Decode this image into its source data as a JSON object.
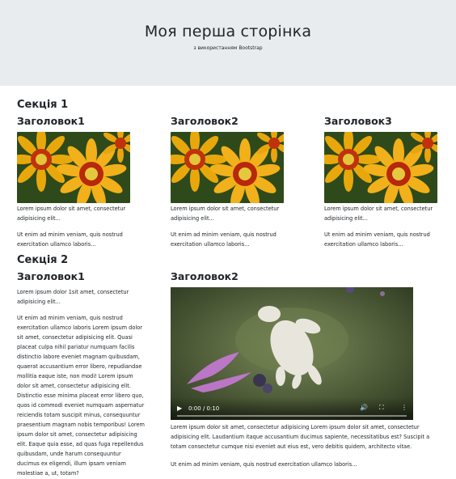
{
  "header": {
    "title": "Моя перша сторінка",
    "subtitle": "з використанням Bootstrap"
  },
  "section1": {
    "title": "Секція 1",
    "columns": [
      {
        "heading": "Заголовок1",
        "p1": "Lorem ipsum dolor sit amet, consectetur adipisicing elit...",
        "p2": "Ut enim ad minim veniam, quis nostrud exercitation ullamco laboris..."
      },
      {
        "heading": "Заголовок2",
        "p1": "Lorem ipsum dolor sit amet, consectetur adipisicing elit...",
        "p2": "Ut enim ad minim veniam, quis nostrud exercitation ullamco laboris..."
      },
      {
        "heading": "Заголовок3",
        "p1": "Lorem ipsum dolor sit amet, consectetur adipisicing elit...",
        "p2": "Ut enim ad minim veniam, quis nostrud exercitation ullamco laboris..."
      }
    ]
  },
  "section2": {
    "title": "Секція 2",
    "left": {
      "heading": "Заголовок1",
      "p1_lines": [
        "Lorem ipsum dolor 1sit amet, consectetur",
        "adipisicing elit..."
      ],
      "p2_lines": [
        "Ut enim ad minim veniam, quis nostrud",
        "exercitation ullamco laboris Lorem ipsum dolor",
        "sit amet, consectetur adipisicing elit. Quasi",
        "placeat culpa nihil pariatur numquam facilis",
        "distinctio labore eveniet magnam quibusdam,",
        "quaerat accusantium error libero, repudiandae",
        "mollitia eaque iste, non modi! Lorem ipsum",
        "dolor sit amet, consectetur adipisicing elit.",
        "Distinctio esse minima placeat error libero quo,",
        "quos id commodi eveniet numquam aspernatur",
        "reiciendis totam suscipit minus, consequuntur",
        "praesentium magnam nobis temporibus! Lorem",
        "ipsum dolor sit amet, consectetur adipisicing",
        "elit. Eaque quia esse, ad quas fuga repellendus",
        "quibusdam, unde harum consequuntur",
        "ducimus ex eligendi, illum ipsam veniam",
        "molestiae a, ut, totam?"
      ]
    },
    "right": {
      "heading": "Заголовок2",
      "video_time": "0:00 / 0:10",
      "p1_lines": [
        "Lorem ipsum dolor sit amet, consectetur adipisicing Lorem ipsum dolor sit amet, consectetur",
        "adipisicing elit. Laudantium itaque accusantium ducimus sapiente, necessitatibus est? Suscipit a",
        "totam consectetur cumque nisi eveniet aut eius est, vero debitis quidem, architecto vitae."
      ],
      "p2": "Ut enim ad minim veniam, quis nostrud exercitation ullamco laboris..."
    }
  }
}
